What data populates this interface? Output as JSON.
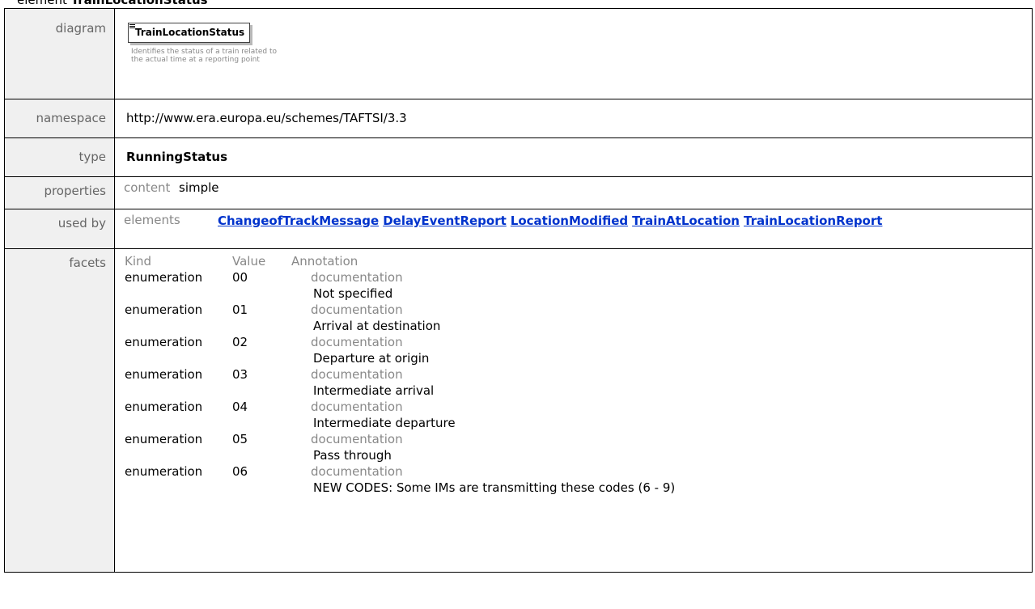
{
  "heading": {
    "prefix": "element",
    "name": "TrainLocationStatus"
  },
  "rows": {
    "diagram_label": "diagram",
    "namespace_label": "namespace",
    "type_label": "type",
    "properties_label": "properties",
    "usedby_label": "used by",
    "facets_label": "facets"
  },
  "diagram": {
    "box_title": "TrainLocationStatus",
    "description": "Identifies the status of a train related to the actual time at a reporting point"
  },
  "namespace": "http://www.era.europa.eu/schemes/TAFTSI/3.3",
  "type": "RunningStatus",
  "properties": {
    "key": "content",
    "value": "simple"
  },
  "used_by": {
    "key": "elements",
    "links": [
      "ChangeofTrackMessage",
      "DelayEventReport",
      "LocationModified",
      "TrainAtLocation",
      "TrainLocationReport"
    ]
  },
  "facets": {
    "headers": {
      "kind": "Kind",
      "value": "Value",
      "annotation": "Annotation"
    },
    "items": [
      {
        "kind": "enumeration",
        "value": "00",
        "doc_label": "documentation",
        "note": "Not specified"
      },
      {
        "kind": "enumeration",
        "value": "01",
        "doc_label": "documentation",
        "note": "Arrival at destination"
      },
      {
        "kind": "enumeration",
        "value": "02",
        "doc_label": "documentation",
        "note": "Departure at origin"
      },
      {
        "kind": "enumeration",
        "value": "03",
        "doc_label": "documentation",
        "note": "Intermediate arrival"
      },
      {
        "kind": "enumeration",
        "value": "04",
        "doc_label": "documentation",
        "note": "Intermediate departure"
      },
      {
        "kind": "enumeration",
        "value": "05",
        "doc_label": "documentation",
        "note": "Pass through"
      },
      {
        "kind": "enumeration",
        "value": "06",
        "doc_label": "documentation",
        "note": "NEW CODES: Some IMs are transmitting these codes (6 - 9)"
      }
    ]
  },
  "colors": {
    "label_bg": "#f0f0f0",
    "label_text": "#666666",
    "link": "#0033cc",
    "border": "#000000"
  }
}
